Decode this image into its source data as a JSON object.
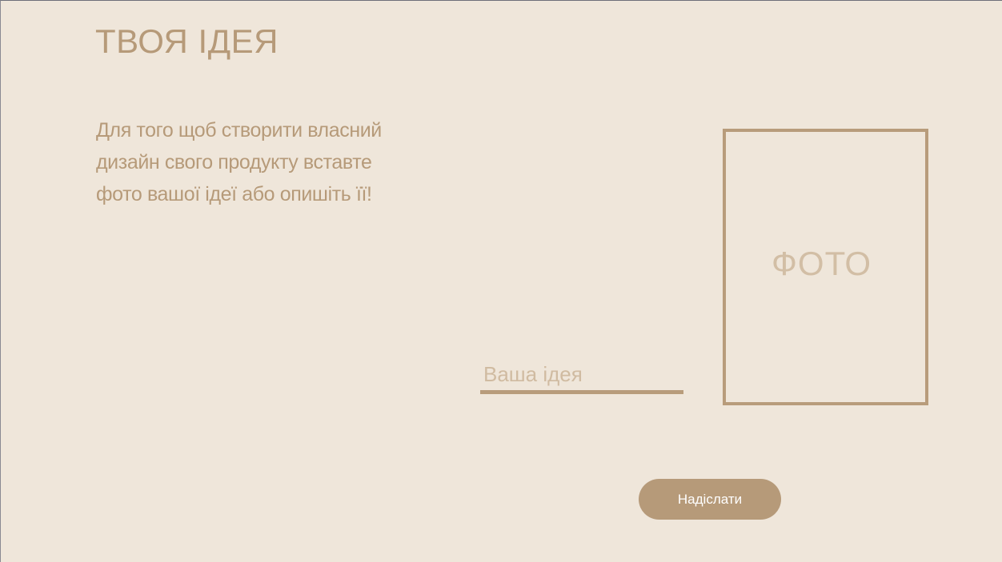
{
  "header": {
    "title": "ТВОЯ ІДЕЯ"
  },
  "intro": {
    "text": "Для того щоб створити власний дизайн свого продукту вставте фото вашої ідеї або опишіть її!"
  },
  "idea_field": {
    "value": "",
    "placeholder": "Ваша ідея"
  },
  "photo_upload": {
    "label": "ФОТО"
  },
  "submit": {
    "label": "Надіслати"
  },
  "colors": {
    "background": "#efe6da",
    "accent": "#b69a79",
    "muted": "#d2bea5",
    "button_text": "#ffffff"
  }
}
